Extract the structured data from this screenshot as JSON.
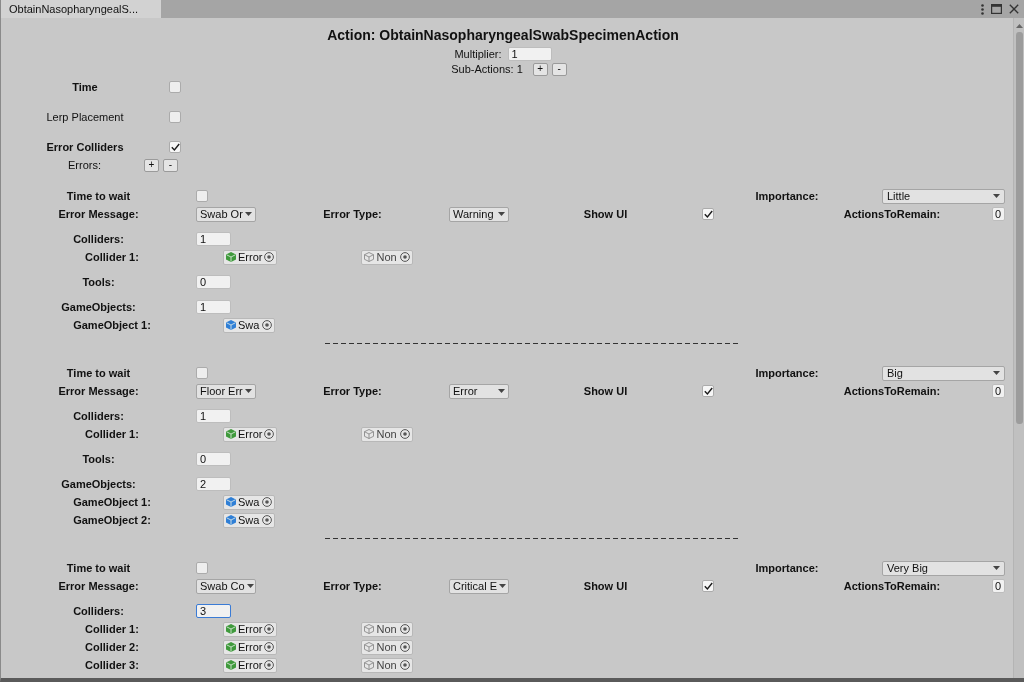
{
  "window": {
    "tabs": [
      {
        "label": "ObtainNasopharyngealS...",
        "selected": true
      }
    ]
  },
  "action": {
    "title": "Action: ObtainNasopharyngealSwabSpecimenAction",
    "multiplier": {
      "label": "Multiplier:",
      "value": "1"
    },
    "sub_actions": {
      "label": "Sub-Actions: 1",
      "buttons": [
        "+",
        "-"
      ]
    }
  },
  "options": [
    {
      "label": "Time",
      "checked": false
    },
    {
      "label": "Lerp Placement",
      "checked": false
    },
    {
      "label": "Error Colliders",
      "checked": true
    }
  ],
  "errors": {
    "label": "Errors:",
    "buttons": [
      "+",
      "-"
    ],
    "items": [
      {
        "time_to_wait": {
          "label": "Time to wait",
          "checked": false
        },
        "importance": {
          "label": "Importance:",
          "value": "Little"
        },
        "error_message": {
          "label": "Error Message:",
          "value": "Swab Or"
        },
        "error_type": {
          "label": "Error Type:",
          "value": "Warning"
        },
        "show_ui": {
          "label": "Show UI",
          "checked": true
        },
        "actions_to_remain": {
          "label": "ActionsToRemain:",
          "value": "0"
        },
        "colliders": {
          "label": "Colliders:",
          "value": "1",
          "focused": false,
          "items": [
            {
              "label": "Collider 1:",
              "slots": [
                {
                  "value": "Error",
                  "assigned": true
                },
                {
                  "value": "Non",
                  "assigned": false
                }
              ]
            }
          ]
        },
        "tools": {
          "label": "Tools:",
          "value": "0",
          "focused": false
        },
        "game_objects": {
          "label": "GameObjects:",
          "value": "1",
          "focused": false,
          "items": [
            {
              "label": "GameObject 1:",
              "slots": [
                {
                  "value": "Swa",
                  "assigned": true
                }
              ]
            }
          ]
        }
      },
      {
        "time_to_wait": {
          "label": "Time to wait",
          "checked": false
        },
        "importance": {
          "label": "Importance:",
          "value": "Big"
        },
        "error_message": {
          "label": "Error Message:",
          "value": "Floor Err"
        },
        "error_type": {
          "label": "Error Type:",
          "value": "Error"
        },
        "show_ui": {
          "label": "Show UI",
          "checked": true
        },
        "actions_to_remain": {
          "label": "ActionsToRemain:",
          "value": "0"
        },
        "colliders": {
          "label": "Colliders:",
          "value": "1",
          "focused": false,
          "items": [
            {
              "label": "Collider 1:",
              "slots": [
                {
                  "value": "Error",
                  "assigned": true
                },
                {
                  "value": "Non",
                  "assigned": false
                }
              ]
            }
          ]
        },
        "tools": {
          "label": "Tools:",
          "value": "0",
          "focused": false
        },
        "game_objects": {
          "label": "GameObjects:",
          "value": "2",
          "focused": false,
          "items": [
            {
              "label": "GameObject 1:",
              "slots": [
                {
                  "value": "Swa",
                  "assigned": true
                }
              ]
            },
            {
              "label": "GameObject 2:",
              "slots": [
                {
                  "value": "Swa",
                  "assigned": true
                }
              ]
            }
          ]
        }
      },
      {
        "time_to_wait": {
          "label": "Time to wait",
          "checked": false
        },
        "importance": {
          "label": "Importance:",
          "value": "Very Big"
        },
        "error_message": {
          "label": "Error Message:",
          "value": "Swab Co"
        },
        "error_type": {
          "label": "Error Type:",
          "value": "Critical E"
        },
        "show_ui": {
          "label": "Show UI",
          "checked": true
        },
        "actions_to_remain": {
          "label": "ActionsToRemain:",
          "value": "0"
        },
        "colliders": {
          "label": "Colliders:",
          "value": "3",
          "focused": true,
          "items": [
            {
              "label": "Collider 1:",
              "slots": [
                {
                  "value": "Error",
                  "assigned": true
                },
                {
                  "value": "Non",
                  "assigned": false
                }
              ]
            },
            {
              "label": "Collider 2:",
              "slots": [
                {
                  "value": "Error",
                  "assigned": true
                },
                {
                  "value": "Non",
                  "assigned": false
                }
              ]
            },
            {
              "label": "Collider 3:",
              "slots": [
                {
                  "value": "Error",
                  "assigned": true
                },
                {
                  "value": "Non",
                  "assigned": false
                }
              ]
            }
          ]
        }
      }
    ]
  }
}
